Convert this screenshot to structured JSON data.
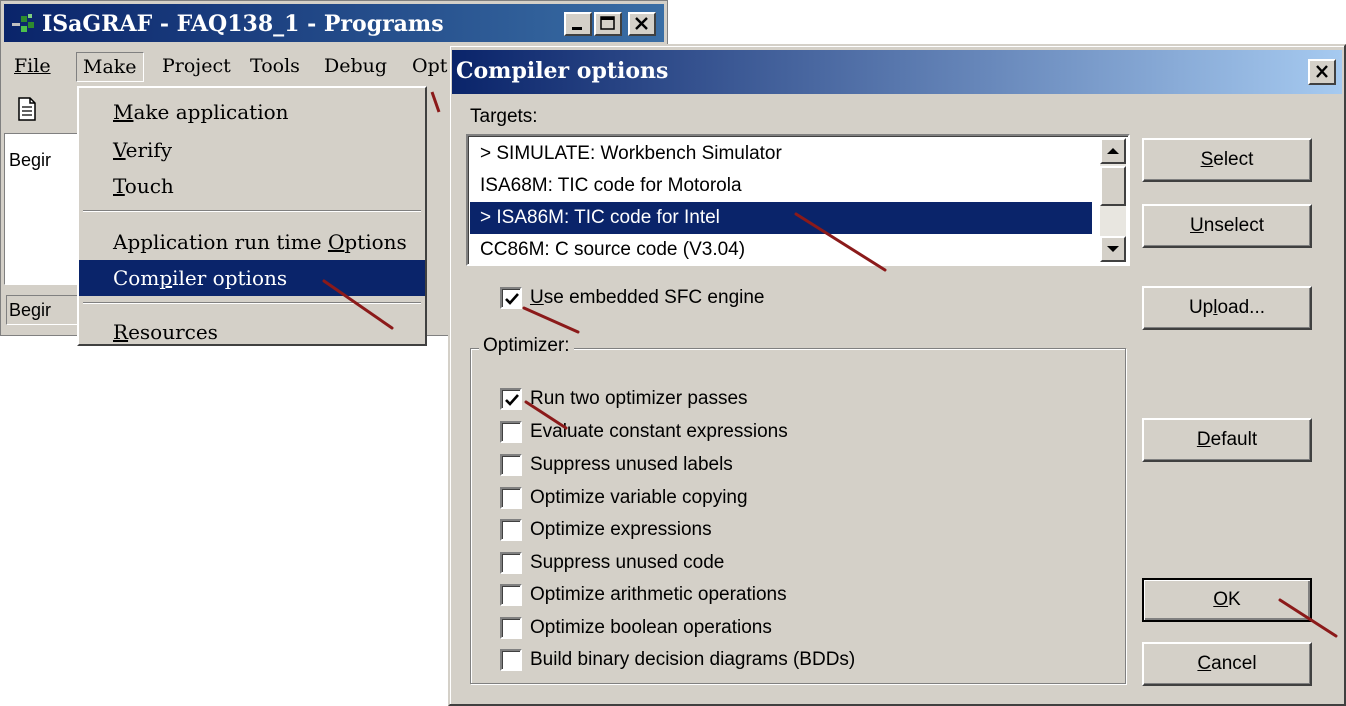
{
  "main_window": {
    "title": "ISaGRAF - FAQ138_1 - Programs",
    "menu": [
      "File",
      "Make",
      "Project",
      "Tools",
      "Debug",
      "Opt"
    ],
    "list_item": "Begir",
    "status_text": "Begir"
  },
  "make_menu": {
    "items": [
      {
        "prefix": "",
        "mnemonic": "M",
        "suffix": "ake application"
      },
      {
        "prefix": "",
        "mnemonic": "V",
        "suffix": "erify"
      },
      {
        "prefix": "",
        "mnemonic": "T",
        "suffix": "ouch"
      },
      {
        "prefix": "Application run time ",
        "mnemonic": "O",
        "suffix": "ptions"
      },
      {
        "prefix": "Com",
        "mnemonic": "p",
        "suffix": "iler options"
      },
      {
        "prefix": "",
        "mnemonic": "R",
        "suffix": "esources"
      }
    ],
    "highlighted": "Compiler options"
  },
  "dialog": {
    "title": "Compiler options",
    "targets_label": "Targets:",
    "targets": [
      {
        "label": "> SIMULATE: Workbench Simulator",
        "selected": false
      },
      {
        "label": "ISA68M: TIC code for Motorola",
        "selected": false
      },
      {
        "label": "> ISA86M: TIC code for Intel",
        "selected": true
      },
      {
        "label": "CC86M: C source code (V3.04)",
        "selected": false
      }
    ],
    "embedded_sfc": {
      "mnemonic": "U",
      "suffix": "se embedded SFC engine",
      "checked": true
    },
    "optimizer_label": "Optimizer:",
    "optimizer_options": [
      {
        "label": "Run two optimizer passes",
        "checked": true
      },
      {
        "label": "Evaluate constant expressions",
        "checked": false
      },
      {
        "label": "Suppress unused labels",
        "checked": false
      },
      {
        "label": "Optimize variable copying",
        "checked": false
      },
      {
        "label": "Optimize expressions",
        "checked": false
      },
      {
        "label": "Suppress unused code",
        "checked": false
      },
      {
        "label": "Optimize arithmetic operations",
        "checked": false
      },
      {
        "label": "Optimize boolean operations",
        "checked": false
      },
      {
        "label": "Build binary decision diagrams (BDDs)",
        "checked": false
      }
    ],
    "buttons": {
      "select": {
        "mnemonic": "S",
        "suffix": "elect"
      },
      "unselect": {
        "mnemonic": "U",
        "suffix": "nselect"
      },
      "upload": {
        "prefix": "Up",
        "mnemonic": "l",
        "suffix": "oad..."
      },
      "default": {
        "mnemonic": "D",
        "suffix": "efault"
      },
      "ok": {
        "mnemonic": "O",
        "suffix": "K"
      },
      "cancel": {
        "mnemonic": "C",
        "suffix": "ancel"
      }
    }
  },
  "colors": {
    "window_face": "#d4d0c8",
    "title_active": "#0a246a",
    "selection": "#0a246a",
    "annotation_marks": "#8b1a1a"
  },
  "icons": [
    "isagraf-logo-icon",
    "minimize-icon",
    "maximize-icon",
    "close-icon",
    "document-icon",
    "scroll-up-icon",
    "scroll-down-icon",
    "checkmark-icon"
  ]
}
